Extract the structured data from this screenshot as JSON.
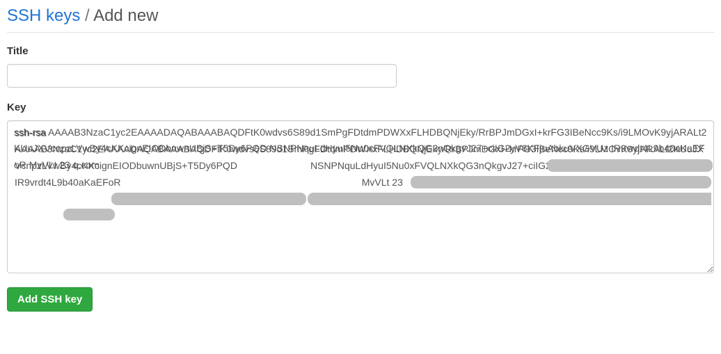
{
  "breadcrumb": {
    "link_label": "SSH keys",
    "separator": "/",
    "current": "Add new"
  },
  "form": {
    "title_label": "Title",
    "title_value": "",
    "key_label": "Key",
    "key_value": "ssh-rsa AAAAB3NzaC1yc2EAAAADAQABAAABAQDFtK0wdvs6S89d1SmPgFDtdmPDWXxFLHDBQNjEky/RrBPJmDGxI+krFG3IBeNcc9Ks/i9LMOvK9yjARALt2KUuJXVcnpzLVwBy4cKKcignEIODbuwnUBjS+T5Dy6PQD                           NSNPNquLdHyuI5Nu0xFVQLNXkQG3nQkgvJ27+ciIG2yV6KFjuAbkuVXGVUz                                                      IR9vrdt4L9b40aKaEFoR                                                                                         MvVLt 23              q.com",
    "submit_label": "Add SSH key"
  }
}
